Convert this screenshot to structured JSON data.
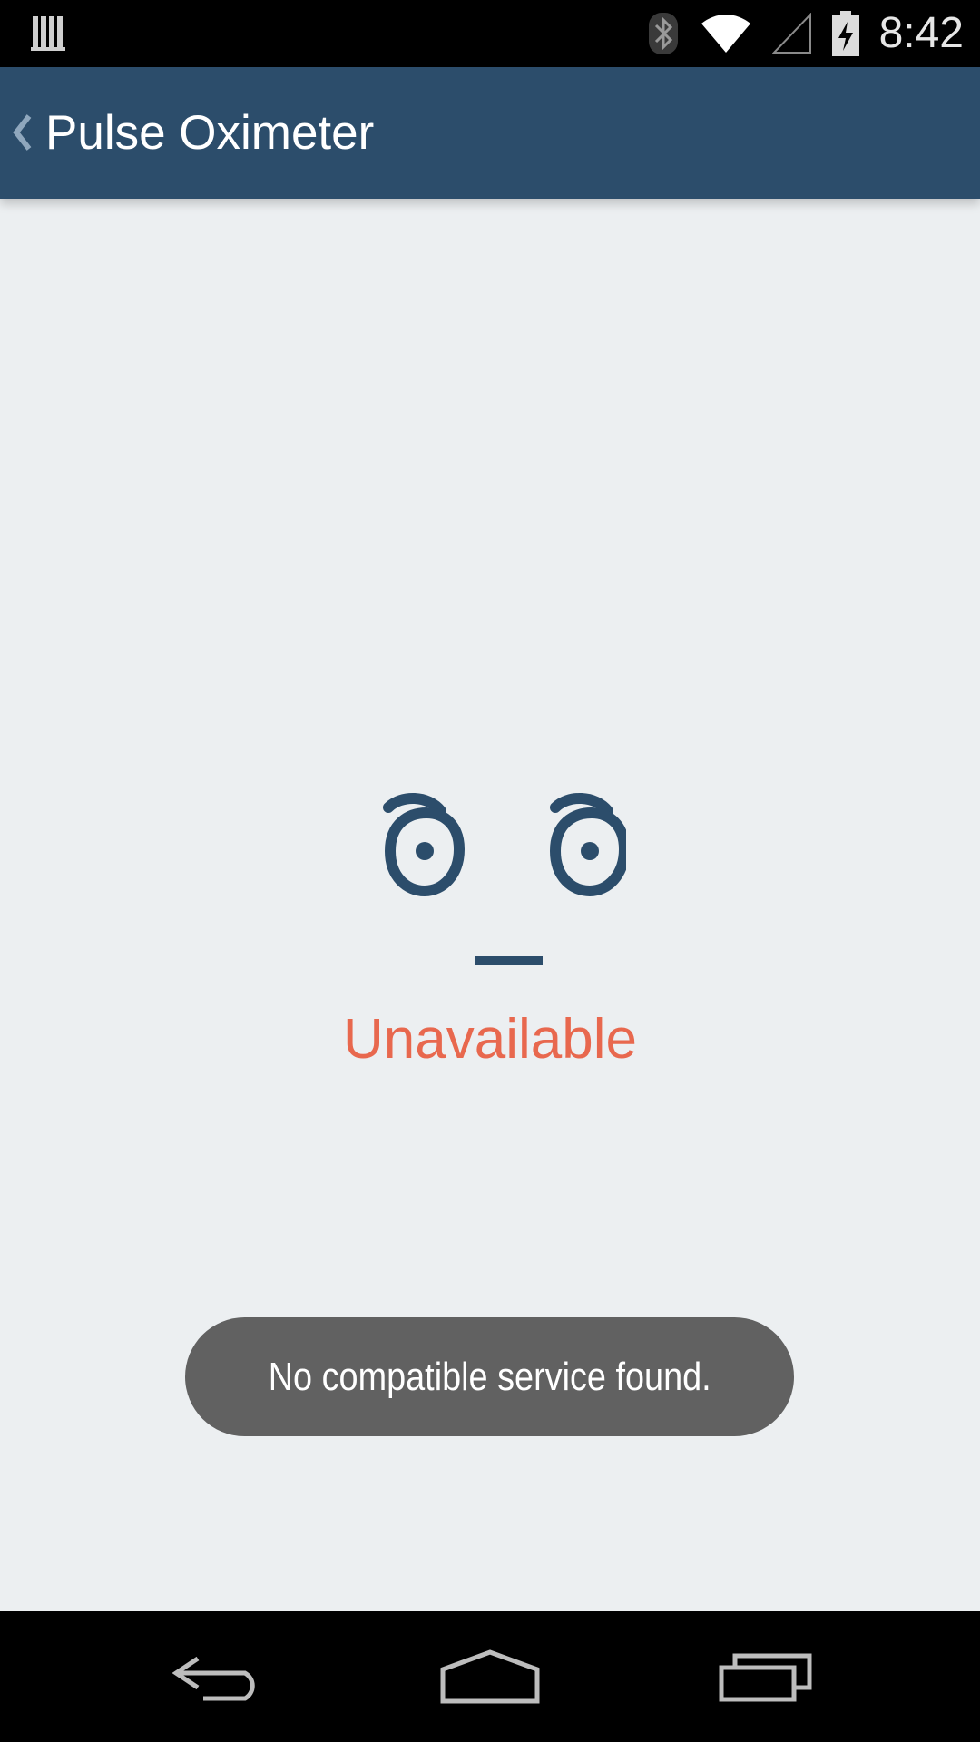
{
  "status_bar": {
    "time": "8:42",
    "icons": [
      "notification-icon",
      "bluetooth-icon",
      "wifi-icon",
      "signal-icon",
      "battery-charging-icon"
    ]
  },
  "app_bar": {
    "title": "Pulse Oximeter",
    "back_icon": "chevron-left-icon"
  },
  "main": {
    "face": "ಠ_ಠ",
    "status_label": "Unavailable"
  },
  "toast": {
    "message": "No compatible service found."
  },
  "nav_bar": {
    "buttons": [
      "back-icon",
      "home-icon",
      "recents-icon"
    ]
  },
  "colors": {
    "app_bar": "#2c4d6b",
    "background": "#eceff1",
    "face": "#2c4d6b",
    "status_label": "#e8684e",
    "toast": "#616161"
  }
}
